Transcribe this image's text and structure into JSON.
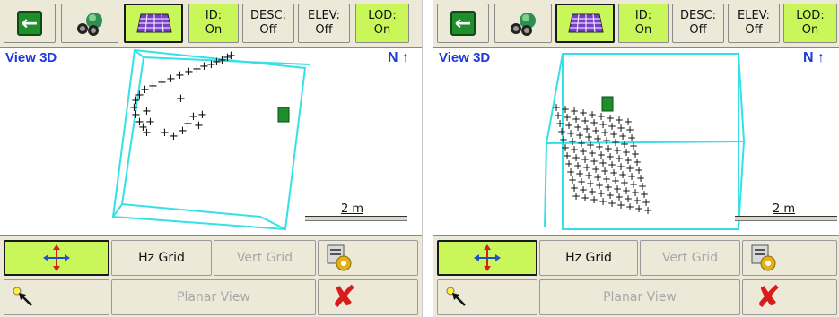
{
  "toolbar": {
    "id_label": "ID:",
    "id_value": "On",
    "desc_label": "DESC:",
    "desc_value": "Off",
    "elev_label": "ELEV:",
    "elev_value": "Off",
    "lod_label": "LOD:",
    "lod_value": "On"
  },
  "view": {
    "title": "View 3D",
    "north_label": "N",
    "scale_label": "2 m"
  },
  "buttons": {
    "hz_grid": "Hz Grid",
    "vert_grid": "Vert Grid",
    "planar_view": "Planar View"
  },
  "colors": {
    "active": "#c9f75a",
    "box": "#35e0e6",
    "title": "#1f3ad6",
    "cancel": "#d81c1c"
  }
}
